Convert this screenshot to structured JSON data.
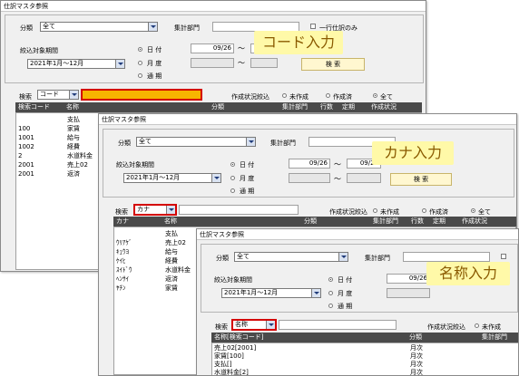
{
  "window_title": "仕訳マスタ参照",
  "labels": {
    "bunrui": "分類",
    "shukei": "集計部門",
    "ichigyou": "一行仕訳のみ",
    "kikan": "絞込対象期間",
    "hizuke": "日 付",
    "getsudo": "月 度",
    "tsuki": "通 期",
    "tilde": "～",
    "kensaku_btn": "検 索",
    "kensaku": "検索",
    "sakusei": "作成状況絞込",
    "misakusei": "未作成",
    "sakuseizumi": "作成済",
    "zenbu": "全て"
  },
  "values": {
    "bunrui_value": "全て",
    "period_value": "2021年1月～12月",
    "date_from": "09/26",
    "date_to": "09/26"
  },
  "window1": {
    "search_mode": "コード",
    "callout": "コード入力",
    "columns": [
      "検索コード",
      "名称",
      "分類",
      "集計部門",
      "行数",
      "定期",
      "作成状況"
    ],
    "rows": [
      {
        "code": "",
        "name": "支払"
      },
      {
        "code": "100",
        "name": "家賃"
      },
      {
        "code": "1001",
        "name": "給与"
      },
      {
        "code": "1002",
        "name": "経費"
      },
      {
        "code": "2",
        "name": "水道料金"
      },
      {
        "code": "2001",
        "name": "売上02"
      },
      {
        "code": "2001",
        "name": "返済"
      }
    ]
  },
  "window2": {
    "search_mode": "カナ",
    "callout": "カナ入力",
    "columns": [
      "カナ",
      "名称",
      "分類",
      "集計部門",
      "行数",
      "定期",
      "作成状況"
    ],
    "rows": [
      {
        "code": "",
        "name": "支払"
      },
      {
        "code": "ｳﾘｱｹﾞ",
        "name": "売上02"
      },
      {
        "code": "ｷｭｳﾖ",
        "name": "給与"
      },
      {
        "code": "ｹｲﾋ",
        "name": "経費"
      },
      {
        "code": "ｽｲﾄﾞｳ",
        "name": "水道料金"
      },
      {
        "code": "ﾍﾝｻｲ",
        "name": "返済"
      },
      {
        "code": "ﾔﾁﾝ",
        "name": "家賃"
      }
    ]
  },
  "window3": {
    "search_mode": "名称",
    "callout": "名称入力",
    "columns": [
      "名称[検索コード]",
      "分類",
      "集計部門"
    ],
    "rows": [
      {
        "name": "売上02[2001]",
        "cat": "月次"
      },
      {
        "name": "家賃[100]",
        "cat": "月次"
      },
      {
        "name": "支払[]",
        "cat": "月次"
      },
      {
        "name": "水道料金[2]",
        "cat": "月次"
      }
    ]
  }
}
